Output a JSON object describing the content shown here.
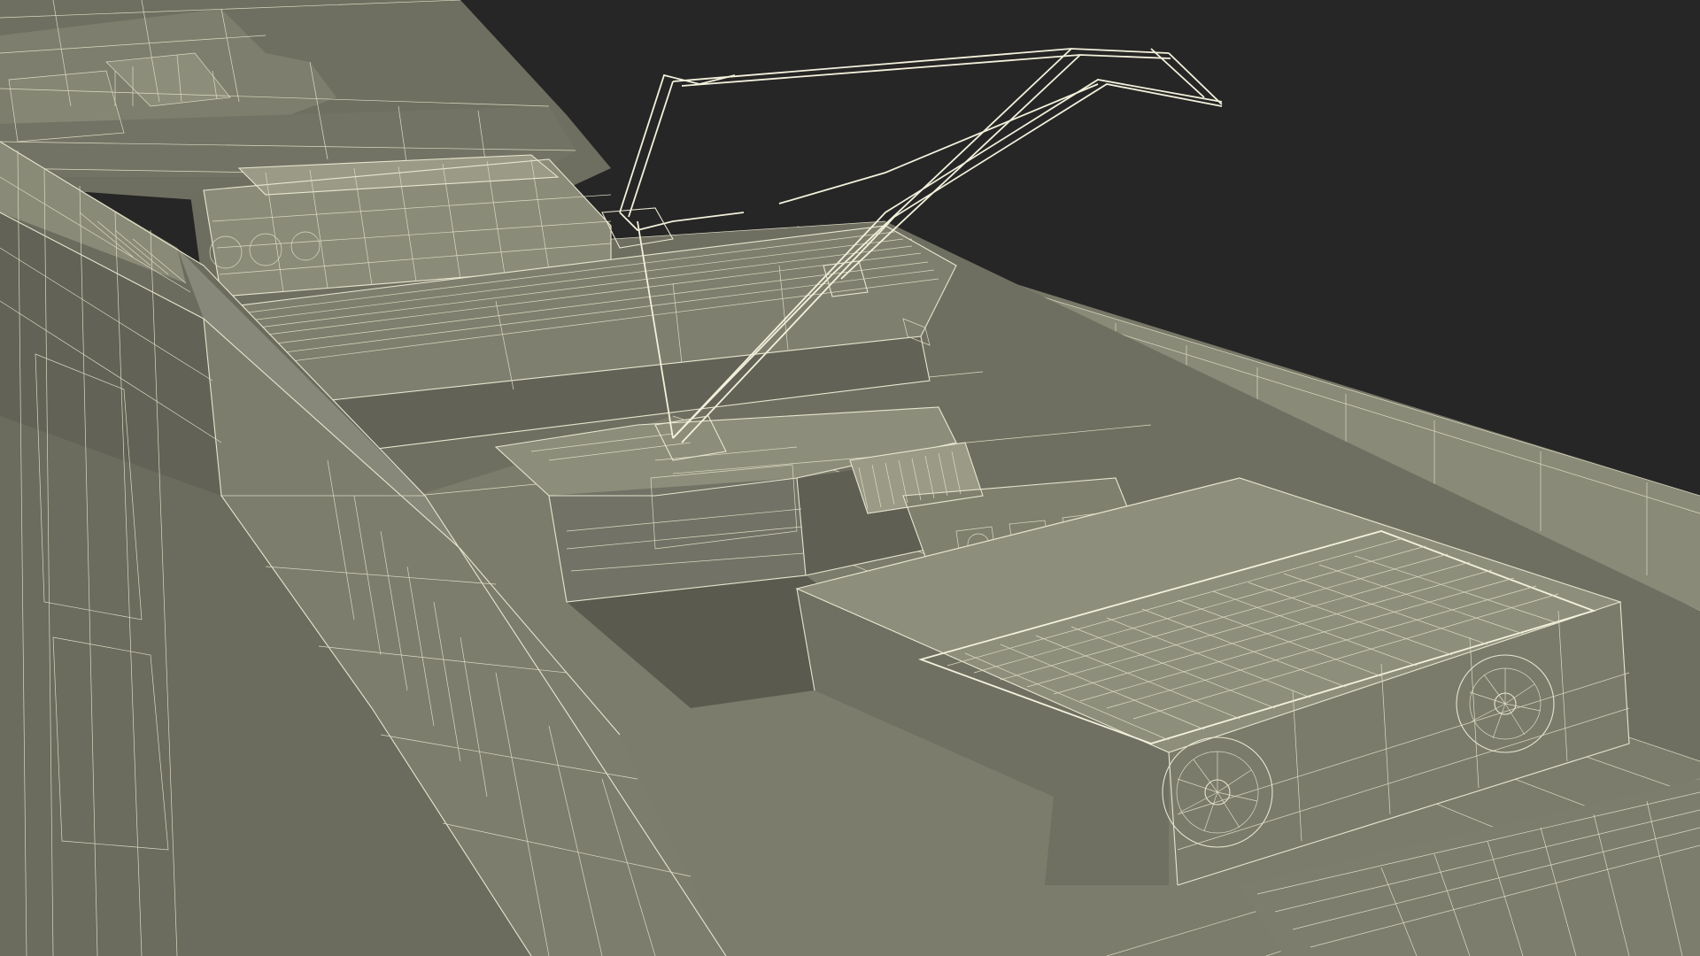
{
  "scene": {
    "subject": "locomotive-roof-wireframe",
    "colors": {
      "background": "#262626",
      "body_fill": "#7b7b6b",
      "body_shadow": "#5e5e52",
      "body_dark": "#4d4d43",
      "body_light": "#8a8a78",
      "wire": "#e8e6cf"
    }
  }
}
